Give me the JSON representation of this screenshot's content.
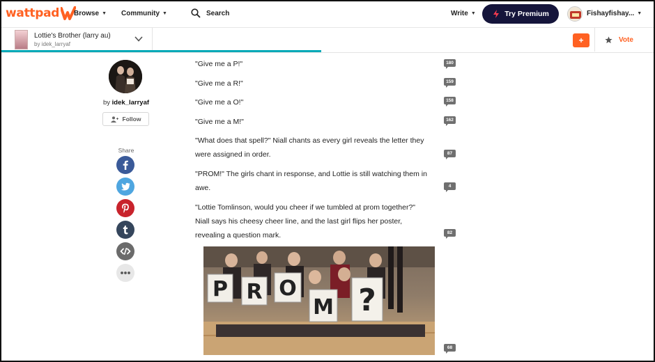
{
  "brand": {
    "logo_text": "wattpad",
    "accent": "#ff6122"
  },
  "topnav": {
    "browse": "Browse",
    "community": "Community",
    "search": "Search",
    "write": "Write",
    "premium": "Try Premium",
    "username": "Fishayfishay..."
  },
  "story": {
    "title": "Lottie's Brother (larry au)",
    "by": "by idek_larryaf",
    "add_label": "+",
    "vote_label": "Vote",
    "reading_progress": 0.49
  },
  "author": {
    "by_prefix": "by ",
    "name": "idek_larryaf",
    "follow_label": "Follow",
    "share_label": "Share"
  },
  "share_icons": [
    "facebook-icon",
    "twitter-icon",
    "pinterest-icon",
    "tumblr-icon",
    "embed-icon",
    "more-icon"
  ],
  "paragraphs": [
    {
      "text": "\"Give me a P!\"",
      "comments": "180"
    },
    {
      "text": "\"Give me a R!\"",
      "comments": "159"
    },
    {
      "text": "\"Give me a O!\"",
      "comments": "158"
    },
    {
      "text": "\"Give me a M!\"",
      "comments": "162"
    },
    {
      "lines": [
        "\"What does that spell?\" Niall chants as every girl reveals the letter they",
        "were assigned in order."
      ],
      "comments": "87"
    },
    {
      "lines": [
        "\"PROM!\" The girls chant in response, and Lottie is still watching them in",
        "awe."
      ],
      "comments": "4"
    },
    {
      "lines": [
        "\"Lottie Tomlinson, would you cheer if we tumbled at prom together?\"",
        "Niall says his cheesy cheer line, and the last girl flips her poster,",
        "revealing a question mark."
      ],
      "comments": "82"
    }
  ],
  "image": {
    "signs": [
      "P",
      "R",
      "O",
      "M",
      "?"
    ],
    "comments": "68"
  }
}
